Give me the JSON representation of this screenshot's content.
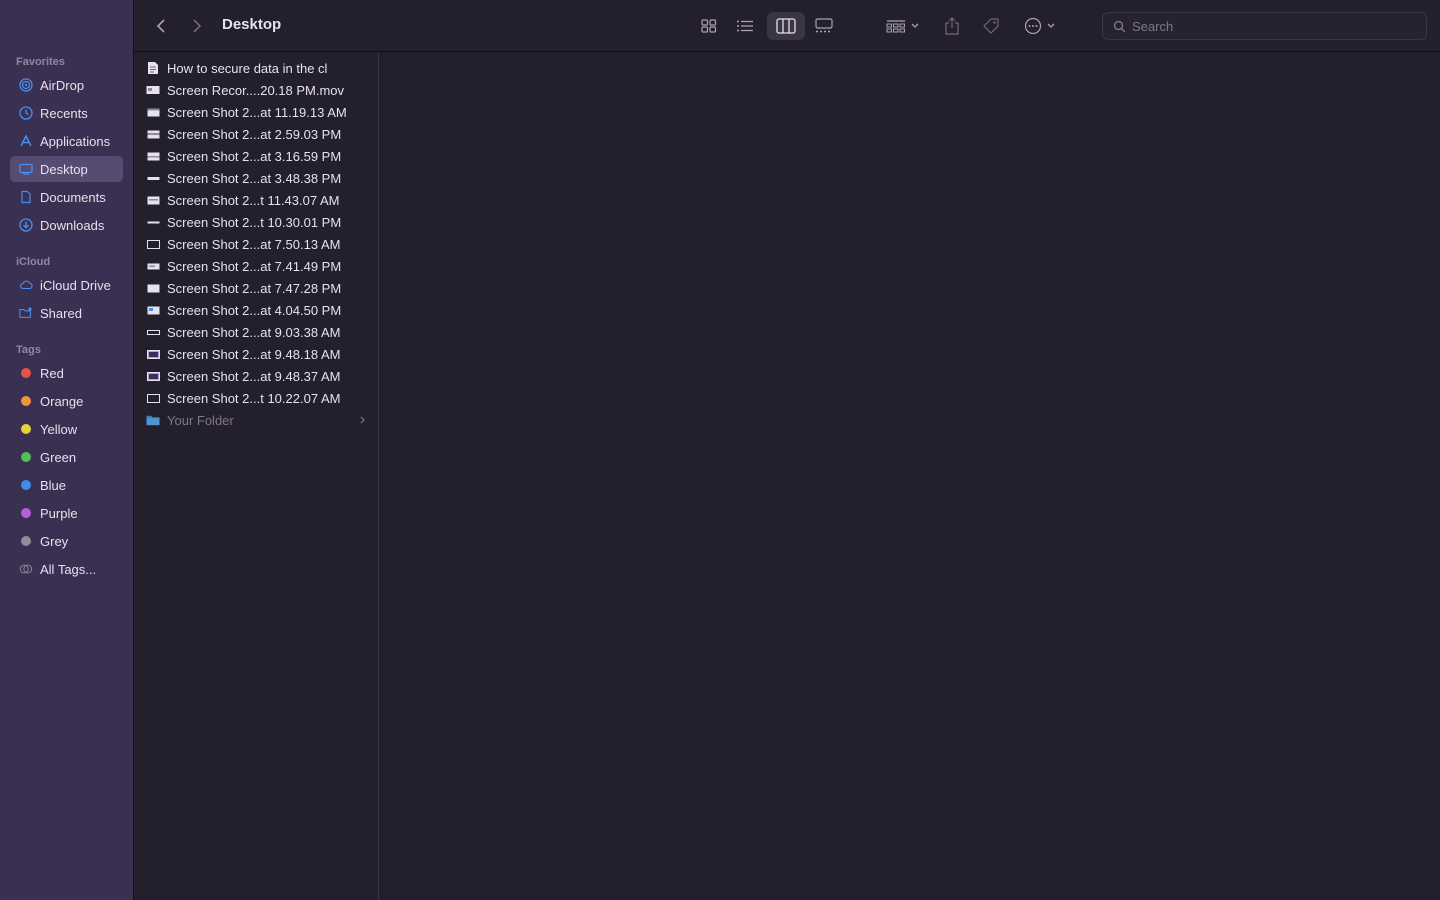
{
  "toolbar": {
    "title": "Desktop",
    "search_placeholder": "Search"
  },
  "sidebar": {
    "favorites_label": "Favorites",
    "favorites": [
      {
        "label": "AirDrop",
        "icon": "airdrop-icon"
      },
      {
        "label": "Recents",
        "icon": "clock-icon"
      },
      {
        "label": "Applications",
        "icon": "applications-icon"
      },
      {
        "label": "Desktop",
        "icon": "desktop-icon",
        "selected": true
      },
      {
        "label": "Documents",
        "icon": "document-icon"
      },
      {
        "label": "Downloads",
        "icon": "download-icon"
      }
    ],
    "icloud_label": "iCloud",
    "icloud": [
      {
        "label": "iCloud Drive",
        "icon": "cloud-icon"
      },
      {
        "label": "Shared",
        "icon": "shared-folder-icon"
      }
    ],
    "tags_label": "Tags",
    "tags": [
      {
        "label": "Red",
        "color": "#e5534b"
      },
      {
        "label": "Orange",
        "color": "#f0953a"
      },
      {
        "label": "Yellow",
        "color": "#e8d03a"
      },
      {
        "label": "Green",
        "color": "#52c05a"
      },
      {
        "label": "Blue",
        "color": "#3a8ee8"
      },
      {
        "label": "Purple",
        "color": "#b85fd8"
      },
      {
        "label": "Grey",
        "color": "#8e8e93"
      }
    ],
    "all_tags_label": "All Tags..."
  },
  "files": [
    {
      "name": "How to secure data in the cl",
      "icon": "text-document-icon"
    },
    {
      "name": "Screen Recor....20.18 PM.mov",
      "icon": "video-file-icon"
    },
    {
      "name": "Screen Shot 2...at 11.19.13 AM",
      "icon": "image-file-icon"
    },
    {
      "name": "Screen Shot 2...at 2.59.03 PM",
      "icon": "image-file-icon"
    },
    {
      "name": "Screen Shot 2...at 3.16.59 PM",
      "icon": "image-file-icon"
    },
    {
      "name": "Screen Shot 2...at 3.48.38 PM",
      "icon": "image-file-icon"
    },
    {
      "name": "Screen Shot 2...t 11.43.07 AM",
      "icon": "image-file-icon"
    },
    {
      "name": "Screen Shot 2...t 10.30.01 PM",
      "icon": "image-file-icon"
    },
    {
      "name": "Screen Shot 2...at 7.50.13 AM",
      "icon": "image-file-icon"
    },
    {
      "name": "Screen Shot 2...at 7.41.49 PM",
      "icon": "image-file-icon"
    },
    {
      "name": "Screen Shot 2...at 7.47.28 PM",
      "icon": "image-file-icon"
    },
    {
      "name": "Screen Shot 2...at 4.04.50 PM",
      "icon": "image-file-icon"
    },
    {
      "name": "Screen Shot 2...at 9.03.38 AM",
      "icon": "image-file-icon"
    },
    {
      "name": "Screen Shot 2...at 9.48.18 AM",
      "icon": "image-file-icon"
    },
    {
      "name": "Screen Shot 2...at 9.48.37 AM",
      "icon": "image-file-icon"
    },
    {
      "name": "Screen Shot 2...t 10.22.07 AM",
      "icon": "image-file-icon"
    }
  ],
  "folder": {
    "name": "Your Folder",
    "icon": "folder-icon"
  },
  "colors": {
    "accent": "#4a8ef0",
    "sidebar_bg": "#3a3152",
    "content_bg": "#231f2c"
  }
}
